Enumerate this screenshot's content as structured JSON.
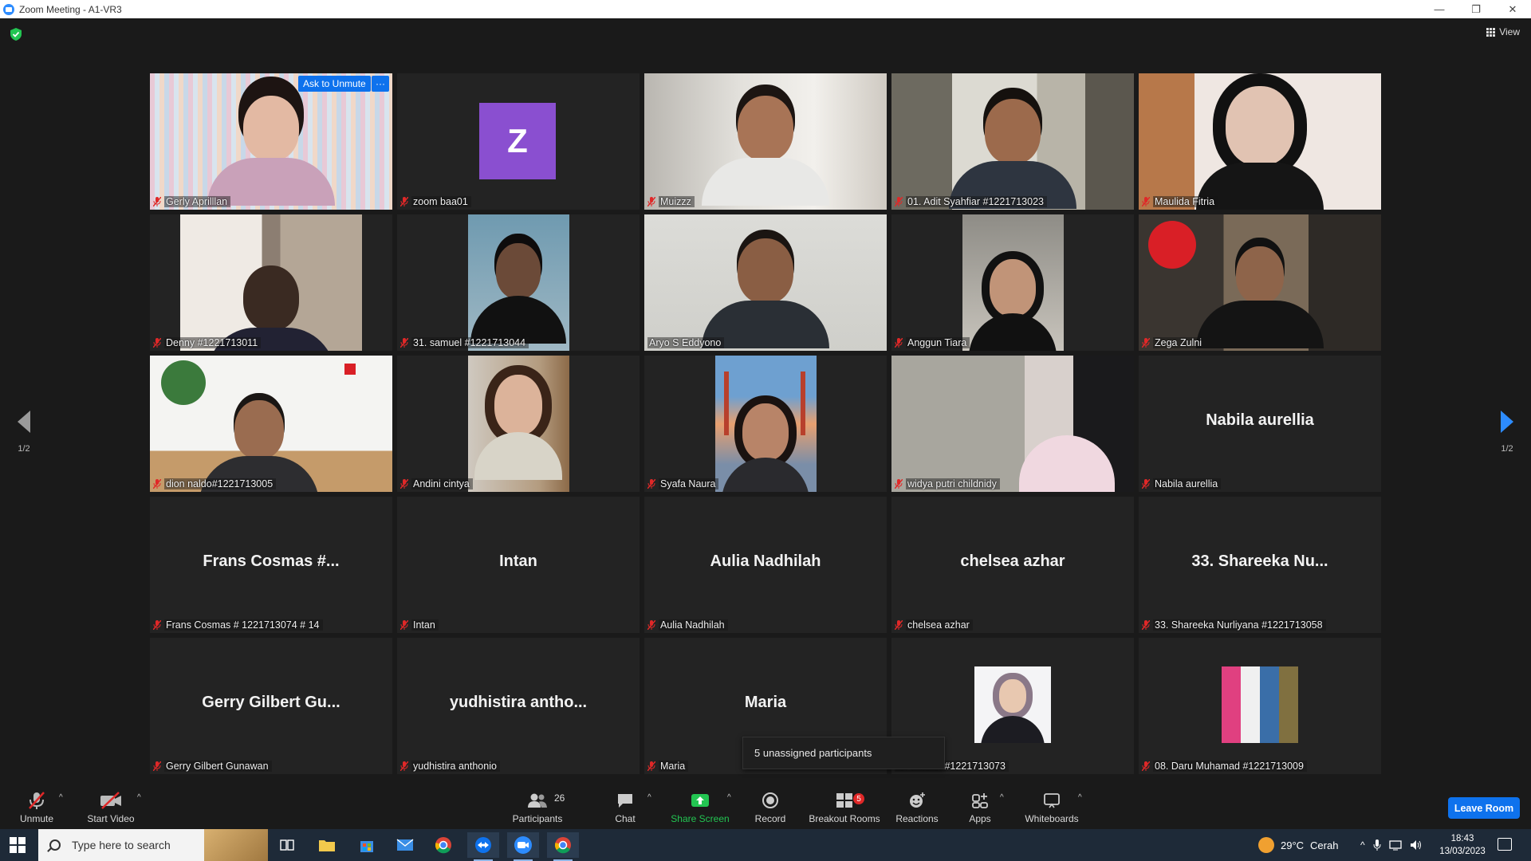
{
  "window": {
    "title": "Zoom Meeting - A1-VR3",
    "minimize": "—",
    "maximize": "❐",
    "close": "✕"
  },
  "top_bar": {
    "view_label": "View"
  },
  "pager": {
    "left": "1/2",
    "right": "1/2"
  },
  "tiles": [
    {
      "name": "Gerly Aprilllan",
      "ask_unmute": "Ask to Unmute",
      "more": "···"
    },
    {
      "name": "zoom baa01",
      "avatar_letter": "Z"
    },
    {
      "name": "Muizzz"
    },
    {
      "name": "01. Adit Syahfiar #1221713023"
    },
    {
      "name": "Maulida Fitria"
    },
    {
      "name": "Denny #1221713011"
    },
    {
      "name": "31. samuel #1221713044"
    },
    {
      "name": "Aryo S Eddyono"
    },
    {
      "name": "Anggun Tiara"
    },
    {
      "name": "Zega Zulni"
    },
    {
      "name": "dion naldo#1221713005"
    },
    {
      "name": "Andini cintya"
    },
    {
      "name": "Syafa Naura"
    },
    {
      "name": "widya putri childnidy"
    },
    {
      "name": "Nabila aurellia",
      "big": "Nabila aurellia"
    },
    {
      "name": "Frans Cosmas # 1221713074 # 14",
      "big": "Frans Cosmas #..."
    },
    {
      "name": "Intan",
      "big": "Intan"
    },
    {
      "name": "Aulia Nadhilah",
      "big": "Aulia Nadhilah"
    },
    {
      "name": "chelsea azhar",
      "big": "chelsea azhar"
    },
    {
      "name": "33. Shareeka Nurliyana #1221713058",
      "big": "33. Shareeka Nu..."
    },
    {
      "name": "Gerry Gilbert Gunawan",
      "big": "Gerry Gilbert Gu..."
    },
    {
      "name": "yudhistira anthonio",
      "big": "yudhistira  antho..."
    },
    {
      "name": "Maria",
      "big": "Maria"
    },
    {
      "name": "an fadillah #1221713073"
    },
    {
      "name": "08. Daru Muhamad #1221713009"
    }
  ],
  "popup": {
    "unassigned": "5 unassigned participants"
  },
  "toolbar": {
    "unmute": "Unmute",
    "start_video": "Start Video",
    "participants": "Participants",
    "participants_count": "26",
    "chat": "Chat",
    "share_screen": "Share Screen",
    "record": "Record",
    "breakout_rooms": "Breakout Rooms",
    "breakout_count": "5",
    "reactions": "Reactions",
    "apps": "Apps",
    "whiteboards": "Whiteboards",
    "leave": "Leave Room"
  },
  "taskbar": {
    "search_placeholder": "Type here to search",
    "temperature": "29°C",
    "weather": "Cerah",
    "time": "18:43",
    "date": "13/03/2023"
  },
  "colors": {
    "accent": "#0e72ed",
    "active_speaker": "#d6ef3e",
    "muted_red": "#e02828",
    "share_green": "#23c552",
    "taskbar": "#1e2a38"
  }
}
